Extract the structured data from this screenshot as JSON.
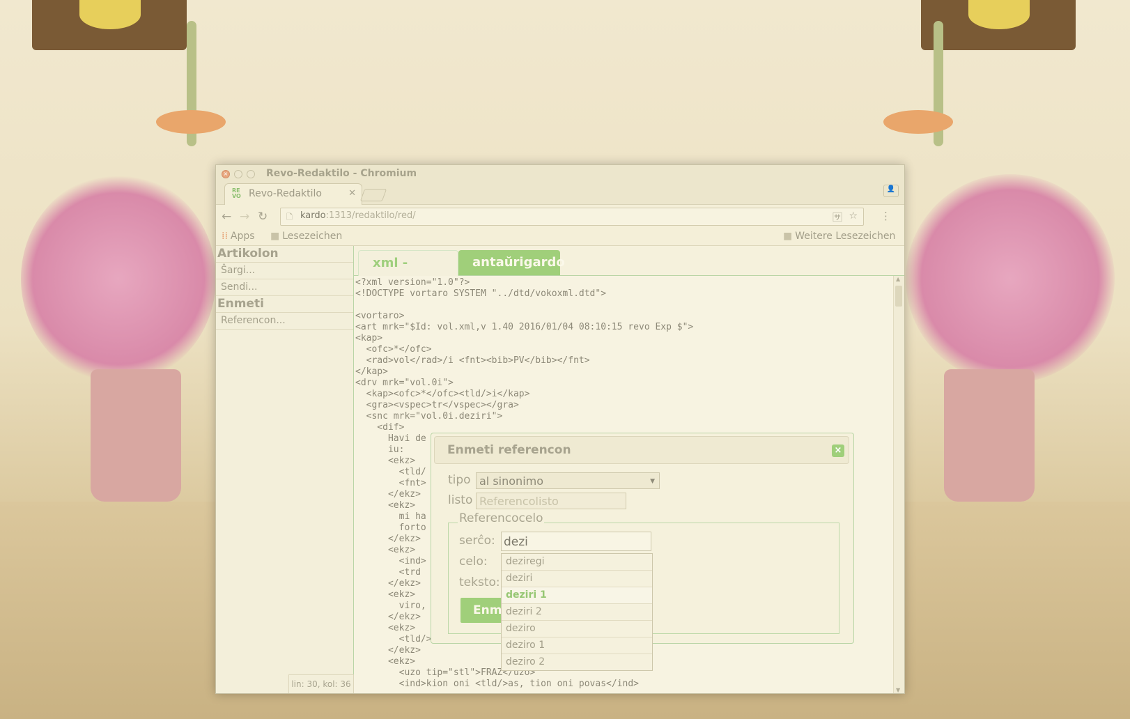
{
  "window": {
    "title": "Revo-Redaktilo - Chromium",
    "tab_label": "Revo-Redaktilo",
    "favicon_text": "RE\nVO"
  },
  "browser": {
    "url_host": "kardo",
    "url_rest": ":1313/redaktilo/red/",
    "bookmarks": [
      "Apps",
      "Lesezeichen"
    ],
    "other_bookmarks": "Weitere Lesezeichen"
  },
  "sidebar": {
    "section1": "Artikolon",
    "items1": [
      "Ŝargi...",
      "Sendi..."
    ],
    "section2": "Enmeti",
    "items2": [
      "Referencon..."
    ],
    "status": "lin: 30, kol: 36"
  },
  "tabs": [
    "xml - redakti",
    "antaŭrigardo"
  ],
  "editor_lines": "<?xml version=\"1.0\"?>\n<!DOCTYPE vortaro SYSTEM \"../dtd/vokoxml.dtd\">\n\n<vortaro>\n<art mrk=\"$Id: vol.xml,v 1.40 2016/01/04 08:10:15 revo Exp $\">\n<kap>\n  <ofc>*</ofc>\n  <rad>vol</rad>/i <fnt><bib>PV</bib></fnt>\n</kap>\n<drv mrk=\"vol.0i\">\n  <kap><ofc>*</ofc><tld/>i</kap>\n  <gra><vspec>tr</vspec></gra>\n  <snc mrk=\"vol.0i.deziri\">\n    <dif>\n      Havi de\n      iu:\n      <ekz>\n        <tld/\n        <fnt>\n      </ekz>\n      <ekz>\n        mi ha\n        forto\n      </ekz>\n      <ekz>\n        <ind>\n        <trd\n      </ekz>\n      <ekz>\n        viro,\n      </ekz>\n      <ekz>\n        <tld/>a, kion vi\n      </ekz>\n      <ekz>\n        <uzo tip=\"stl\">FRAZ</uzo>\n        <ind>kion oni <tld/>as, tion oni povas</ind>",
  "dialog": {
    "title": "Enmeti referencon",
    "tipo_label": "tipo",
    "tipo_value": "al sinonimo",
    "listo_label": "listo",
    "listo_placeholder": "Referencolisto",
    "fieldset_legend": "Referencocelo",
    "sercho_label": "serĉo:",
    "sercho_value": "dezi",
    "celo_label": "celo:",
    "teksto_label": "teksto:",
    "submit_label": "Enm"
  },
  "autocomplete": {
    "options": [
      "deziregi",
      "deziri",
      "deziri 1",
      "deziri 2",
      "deziro",
      "deziro 1",
      "deziro 2"
    ],
    "highlighted_index": 2
  }
}
